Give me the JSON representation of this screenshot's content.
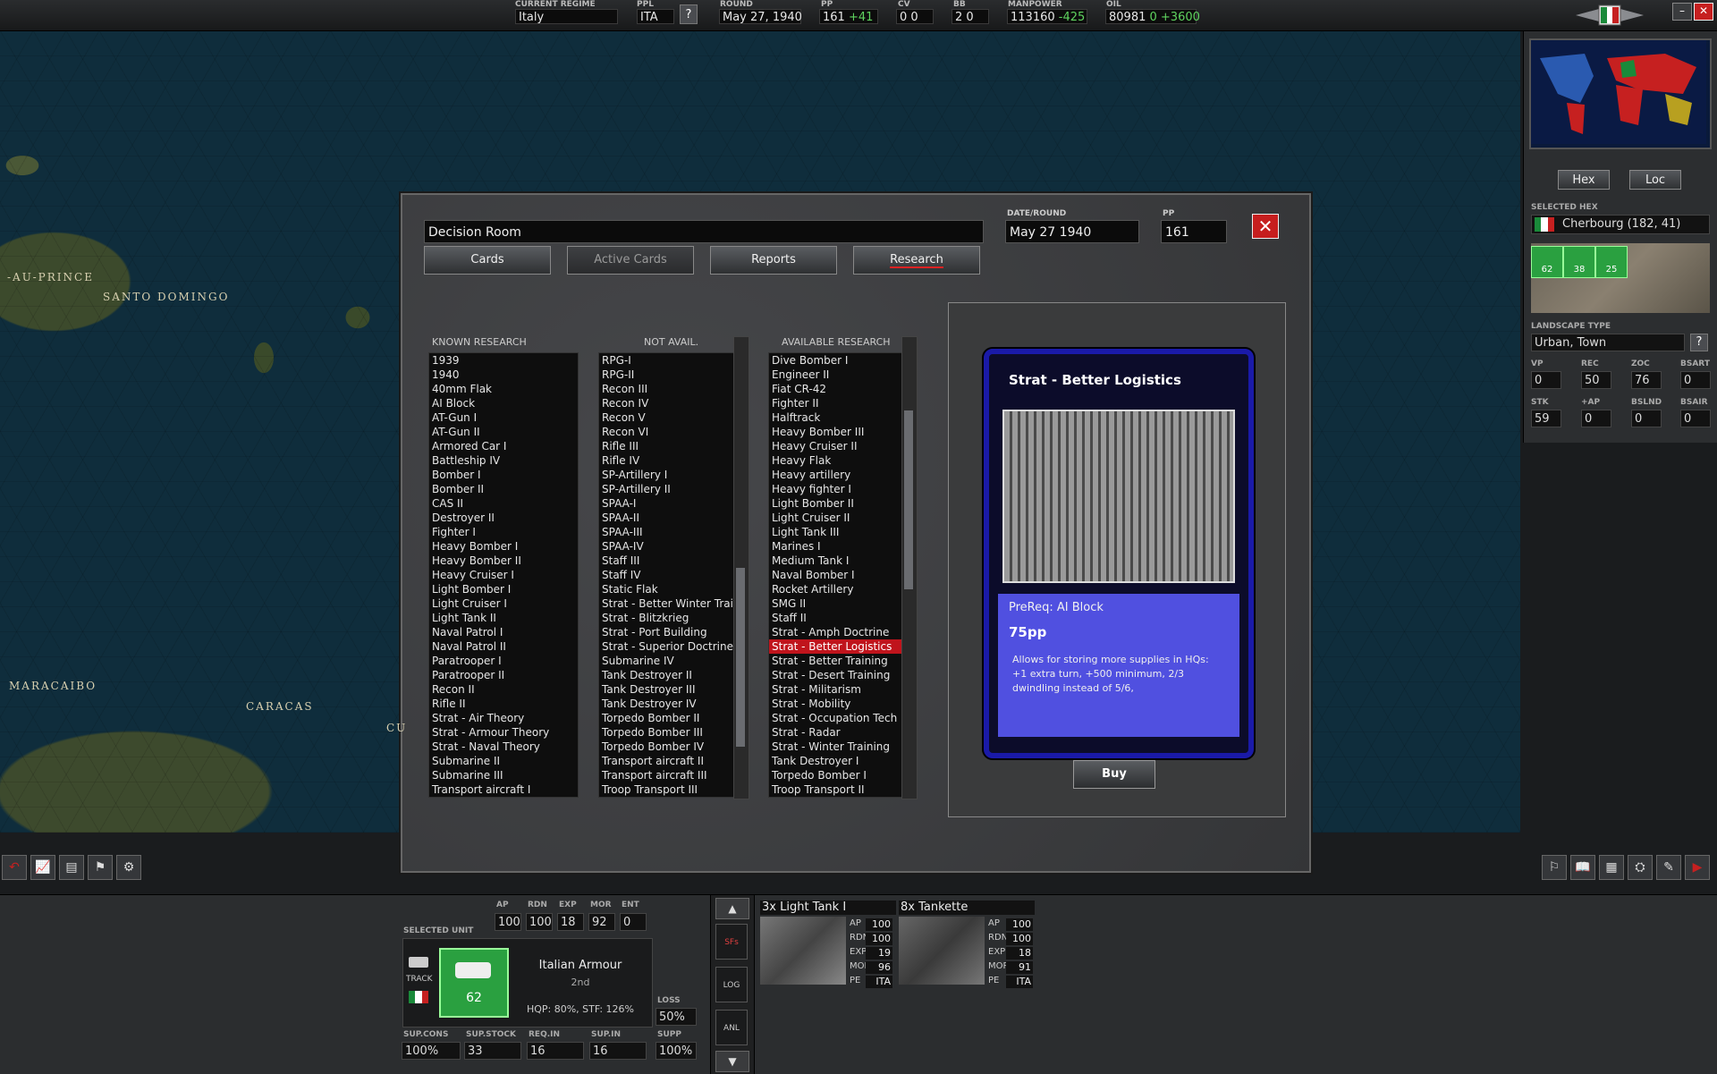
{
  "topbar": {
    "regime_label": "CURRENT REGIME",
    "regime": "Italy",
    "ppl_label": "PPL",
    "ppl": "ITA",
    "help": "?",
    "round_label": "ROUND",
    "round": "May 27, 1940",
    "pp_label": "PP",
    "pp": "161",
    "pp_delta": "+41",
    "cv_label": "CV",
    "cv": "0 0",
    "bb_label": "BB",
    "bb": "2 0",
    "manpower_label": "MANPOWER",
    "manpower": "113160",
    "manpower_delta": "-425",
    "oil_label": "OIL",
    "oil": "80981",
    "oil_delta": "0 +3600"
  },
  "map": {
    "labels": [
      "-AU-PRINCE",
      "SANTO DOMINGO",
      "MARACAIBO",
      "CARACAS",
      "CU"
    ]
  },
  "right_panel": {
    "hex_btn": "Hex",
    "loc_btn": "Loc",
    "selected_hex_label": "SELECTED HEX",
    "selected_hex": "Cherbourg (182, 41)",
    "units": [
      "62",
      "38",
      "25"
    ],
    "landscape_label": "LANDSCAPE TYPE",
    "landscape": "Urban, Town",
    "help": "?",
    "stats1": [
      {
        "label": "VP",
        "value": "0"
      },
      {
        "label": "REC",
        "value": "50"
      },
      {
        "label": "ZOC",
        "value": "76"
      },
      {
        "label": "BSART",
        "value": "0"
      }
    ],
    "stats2": [
      {
        "label": "STK",
        "value": "59"
      },
      {
        "label": "+AP",
        "value": "0"
      },
      {
        "label": "BSLND",
        "value": "0"
      },
      {
        "label": "BSAIR",
        "value": "0"
      }
    ]
  },
  "modal": {
    "title": "Decision Room",
    "date_label": "DATE/ROUND",
    "date": "May 27 1940",
    "pp_label": "PP",
    "pp": "161",
    "close": "✕",
    "tabs": [
      "Cards",
      "Active Cards",
      "Reports",
      "Research"
    ],
    "known_label": "KNOWN RESEARCH",
    "notavail_label": "NOT AVAIL.",
    "available_label": "AVAILABLE RESEARCH",
    "known": [
      "1939",
      "1940",
      "40mm Flak",
      "AI Block",
      "AT-Gun I",
      "AT-Gun II",
      "Armored Car I",
      "Battleship IV",
      "Bomber I",
      "Bomber II",
      "CAS II",
      "Destroyer II",
      "Fighter I",
      "Heavy Bomber I",
      "Heavy Bomber II",
      "Heavy Cruiser I",
      "Light Bomber I",
      "Light Cruiser I",
      "Light Tank II",
      "Naval Patrol I",
      "Naval Patrol II",
      "Paratrooper I",
      "Paratrooper II",
      "Recon II",
      "Rifle II",
      "Strat - Air Theory",
      "Strat - Armour Theory",
      "Strat - Naval Theory",
      "Submarine II",
      "Submarine III",
      "Transport aircraft I"
    ],
    "notavail": [
      "RPG-I",
      "RPG-II",
      "Recon III",
      "Recon IV",
      "Recon V",
      "Recon VI",
      "Rifle III",
      "Rifle IV",
      "SP-Artillery I",
      "SP-Artillery II",
      "SPAA-I",
      "SPAA-II",
      "SPAA-III",
      "SPAA-IV",
      "Staff III",
      "Staff IV",
      "Static Flak",
      "Strat - Better Winter Training",
      "Strat - Blitzkrieg",
      "Strat - Port Building",
      "Strat - Superior Doctrines",
      "Submarine IV",
      "Tank Destroyer II",
      "Tank Destroyer III",
      "Tank Destroyer IV",
      "Torpedo Bomber II",
      "Torpedo Bomber III",
      "Torpedo Bomber IV",
      "Transport aircraft II",
      "Transport aircraft III",
      "Troop Transport III"
    ],
    "available": [
      "Dive Bomber I",
      "Engineer II",
      "Fiat CR-42",
      "Fighter II",
      "Halftrack",
      "Heavy Bomber III",
      "Heavy Cruiser II",
      "Heavy Flak",
      "Heavy artillery",
      "Heavy fighter I",
      "Light Bomber II",
      "Light Cruiser II",
      "Light Tank III",
      "Marines I",
      "Medium Tank I",
      "Naval Bomber I",
      "Rocket Artillery",
      "SMG II",
      "Staff II",
      "Strat - Amph Doctrine",
      "Strat - Better Logistics",
      "Strat - Better Training",
      "Strat - Desert Training",
      "Strat - Militarism",
      "Strat - Mobility",
      "Strat - Occupation Tech",
      "Strat - Radar",
      "Strat - Winter Training",
      "Tank Destroyer I",
      "Torpedo Bomber I",
      "Troop Transport II"
    ],
    "selected_available": "Strat - Better Logistics",
    "card": {
      "title": "Strat - Better Logistics",
      "prereq": "PreReq: AI Block",
      "cost": "75pp",
      "description": "Allows for storing more supplies in HQs: +1 extra turn, +500 minimum, 2/3 dwindling instead of 5/6,"
    },
    "buy": "Buy"
  },
  "bottom": {
    "ap_label": "AP",
    "ap": "100",
    "rdn_label": "RDN",
    "rdn": "100",
    "exp_label": "EXP",
    "exp": "18",
    "mor_label": "MOR",
    "mor": "92",
    "ent_label": "ENT",
    "ent": "0",
    "selected_unit_label": "SELECTED UNIT",
    "track": "TRACK",
    "unit_name": "Italian Armour",
    "unit_sub": "2nd",
    "unit_strength": "62",
    "hqp": "HQP: 80%, STF: 126%",
    "loss_label": "LOSS",
    "loss": "50%",
    "supcons_label": "SUP.CONS",
    "supcons": "100%",
    "supstock_label": "SUP.STOCK",
    "supstock": "33",
    "reqin_label": "REQ.IN",
    "reqin": "16",
    "supin_label": "SUP.IN",
    "supin": "16",
    "supp_label": "SUPP",
    "supp": "100%",
    "side_buttons": [
      "SFs",
      "LOG",
      "ANL"
    ],
    "sub1": {
      "name": "3x Light Tank I",
      "stats": [
        {
          "l": "AP",
          "v": "100"
        },
        {
          "l": "RDN",
          "v": "100"
        },
        {
          "l": "EXP",
          "v": "19"
        },
        {
          "l": "MOR",
          "v": "96"
        },
        {
          "l": "PE",
          "v": "ITA"
        }
      ]
    },
    "sub2": {
      "name": "8x Tankette",
      "stats": [
        {
          "l": "AP",
          "v": "100"
        },
        {
          "l": "RDN",
          "v": "100"
        },
        {
          "l": "EXP",
          "v": "18"
        },
        {
          "l": "MOR",
          "v": "91"
        },
        {
          "l": "PE",
          "v": "ITA"
        }
      ]
    }
  }
}
